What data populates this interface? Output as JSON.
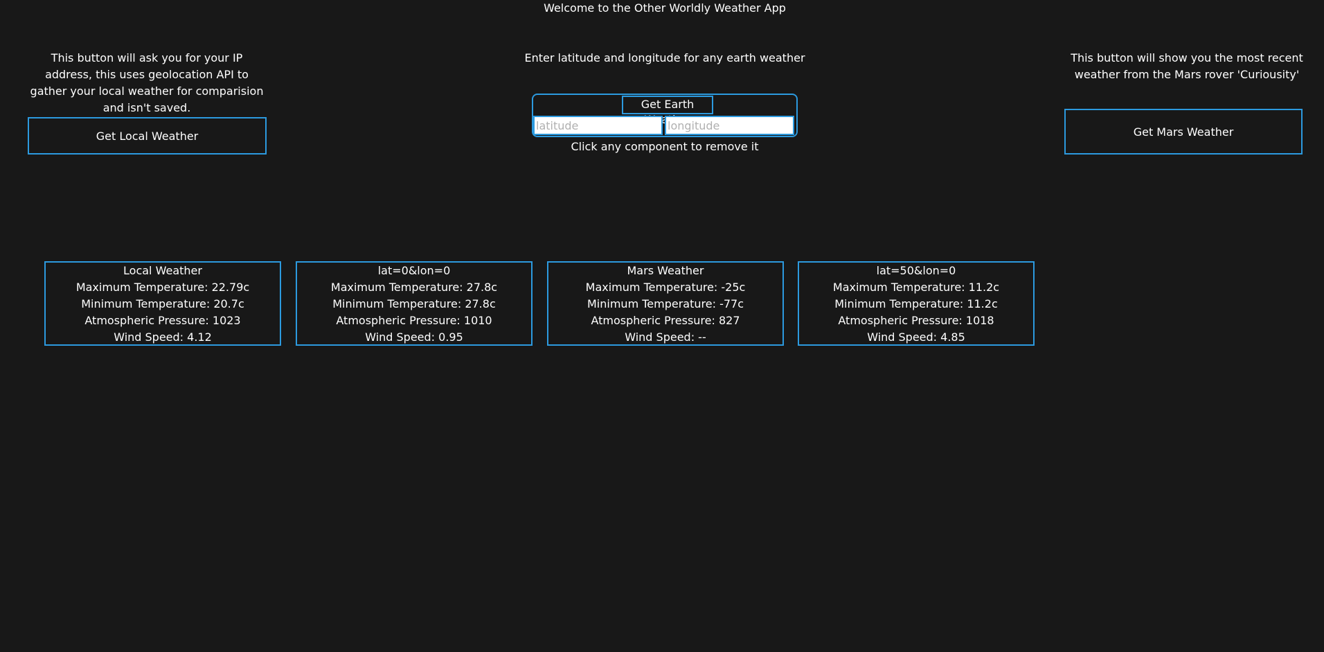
{
  "header": {
    "title": "Welcome to the Other Worldly Weather App"
  },
  "local_panel": {
    "description": "This button will ask you for your IP address, this uses geolocation API to gather your local weather for comparision and isn't saved.",
    "button_label": "Get Local Weather"
  },
  "earth_panel": {
    "description": "Enter latitude and longitude for any earth weather",
    "button_label": "Get Earth Weather",
    "latitude_placeholder": "latitude",
    "latitude_value": "",
    "longitude_placeholder": "longitude",
    "longitude_value": "",
    "remove_hint": "Click any component to remove it"
  },
  "mars_panel": {
    "description": "This button will show you the most recent weather from the Mars rover 'Curiousity'",
    "button_label": "Get Mars Weather"
  },
  "cards": [
    {
      "title": "Local Weather",
      "max_temp": "Maximum Temperature: 22.79c",
      "min_temp": "Minimum Temperature: 20.7c",
      "pressure": "Atmospheric Pressure: 1023",
      "wind": "Wind Speed: 4.12"
    },
    {
      "title": "lat=0&lon=0",
      "max_temp": "Maximum Temperature: 27.8c",
      "min_temp": "Minimum Temperature: 27.8c",
      "pressure": "Atmospheric Pressure: 1010",
      "wind": "Wind Speed: 0.95"
    },
    {
      "title": "Mars Weather",
      "max_temp": "Maximum Temperature: -25c",
      "min_temp": "Minimum Temperature: -77c",
      "pressure": "Atmospheric Pressure: 827",
      "wind": "Wind Speed: --"
    },
    {
      "title": "lat=50&lon=0",
      "max_temp": "Maximum Temperature: 11.2c",
      "min_temp": "Minimum Temperature: 11.2c",
      "pressure": "Atmospheric Pressure: 1018",
      "wind": "Wind Speed: 4.85"
    }
  ],
  "colors": {
    "background": "#181818",
    "accent_border": "#2c9adf",
    "text": "#ffffff"
  }
}
